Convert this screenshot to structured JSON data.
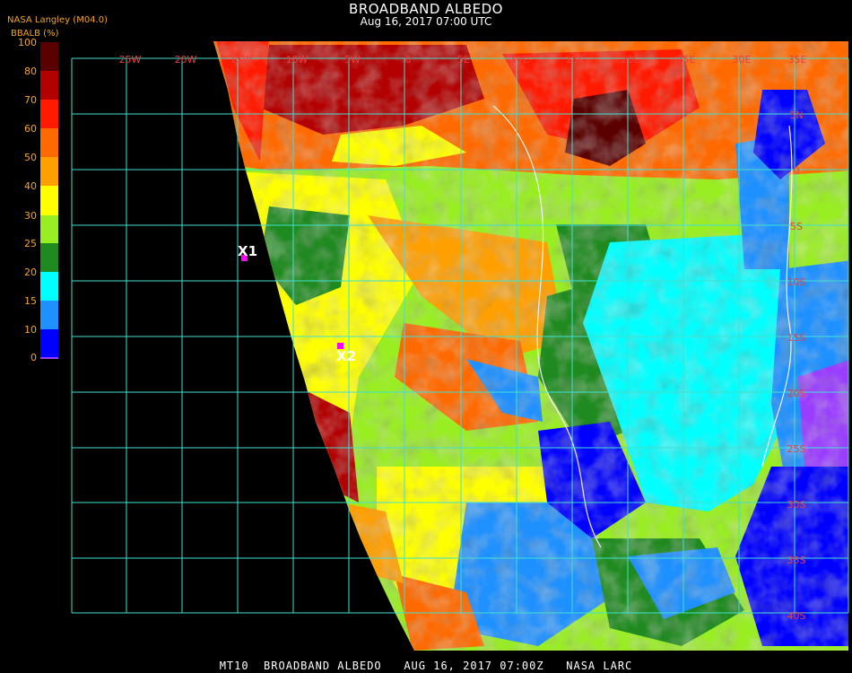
{
  "header": {
    "title": "BROADBAND ALBEDO",
    "subtitle": "Aug 16, 2017 07:00 UTC",
    "source": "NASA Langley (M04.0)",
    "unit": "BBALB (%)"
  },
  "legend": {
    "ticks": [
      "100",
      "80",
      "70",
      "60",
      "50",
      "40",
      "30",
      "25",
      "20",
      "15",
      "10",
      "0"
    ],
    "colors": [
      "#5a0000",
      "#b30000",
      "#ff1a00",
      "#ff6a00",
      "#ff9f00",
      "#ffff00",
      "#99ee22",
      "#1f8a1f",
      "#00ffff",
      "#1e90ff",
      "#0000ff",
      "#9a3dff"
    ]
  },
  "map": {
    "top_labels": [
      "25W",
      "20W",
      "15W",
      "10W",
      "5W",
      "0",
      "5E",
      "10E",
      "15E",
      "20E",
      "25E",
      "30E",
      "35E"
    ],
    "right_labels": [
      "5N",
      "0",
      "5S",
      "10S",
      "15S",
      "20S",
      "25S",
      "30S",
      "35S",
      "40S"
    ],
    "markers": [
      {
        "label": "X1",
        "color": "#ff00ff"
      },
      {
        "label": "X2",
        "color": "#ff00ff"
      }
    ],
    "grid_color": "#40e0d0",
    "label_color": "#e84040"
  },
  "footer": {
    "text": "MT10  BROADBAND ALBEDO   AUG 16, 2017 07:00Z   NASA LARC"
  }
}
